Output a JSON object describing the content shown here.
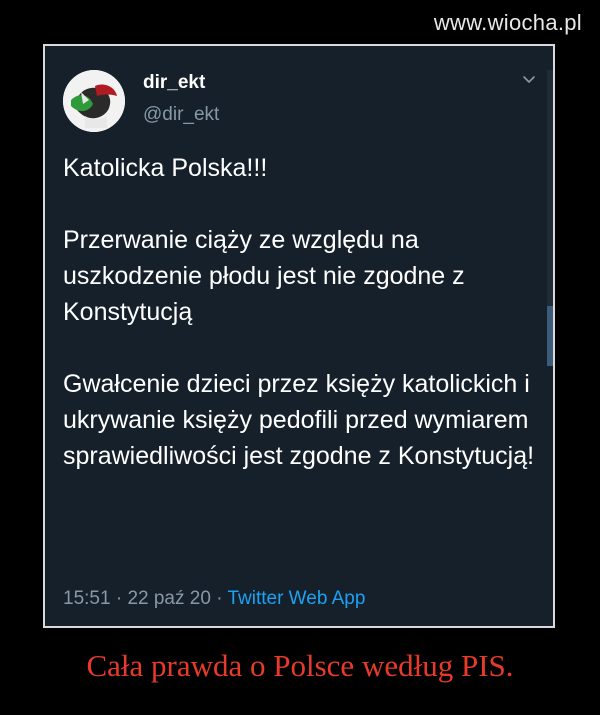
{
  "watermark": "www.wiocha.pl",
  "tweet": {
    "display_name": "dir_ekt",
    "handle": "@dir_ekt",
    "paragraphs": [
      "Katolicka Polska!!!",
      "Przerwanie ciąży ze względu na uszkodzenie płodu jest nie zgodne z Konstytucją",
      "Gwałcenie dzieci przez księży katolickich i ukrywanie księży pedofili przed wymiarem sprawiedliwości jest zgodne z Konstytucją!"
    ],
    "time": "15:51",
    "date": "22 paź 20",
    "separator": "·",
    "source": "Twitter Web App",
    "menu_icon": "chevron-down-icon"
  },
  "caption": "Cała prawda o Polsce według PIS.",
  "colors": {
    "background": "#000000",
    "card": "#15202b",
    "border": "#d9d9d9",
    "text": "#ffffff",
    "muted": "#8899a6",
    "link": "#1da1f2",
    "caption": "#e83a2a"
  }
}
